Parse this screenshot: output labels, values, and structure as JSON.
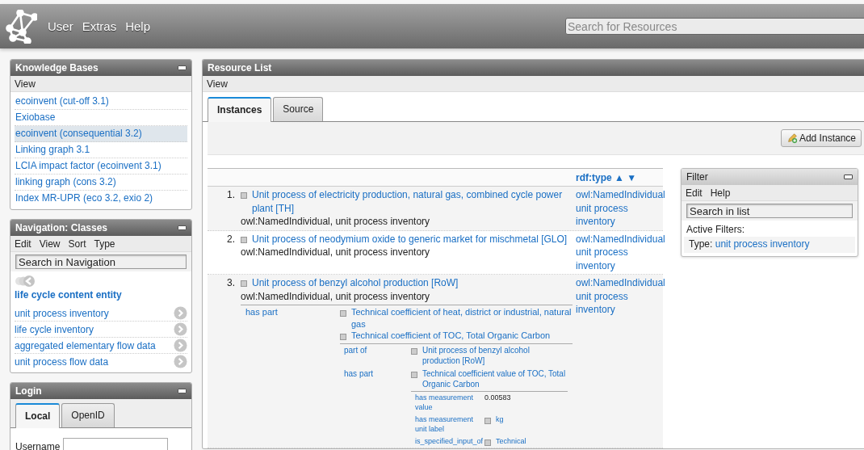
{
  "header": {
    "menu": [
      "User",
      "Extras",
      "Help"
    ],
    "search": {
      "placeholder": "Search for Resources"
    }
  },
  "knowledge_bases": {
    "title": "Knowledge Bases",
    "menu": [
      "View"
    ],
    "items": [
      {
        "label": "ecoinvent (cut-off 3.1)",
        "selected": false
      },
      {
        "label": "Exiobase",
        "selected": false
      },
      {
        "label": "ecoinvent (consequential 3.2)",
        "selected": true
      },
      {
        "label": "Linking graph 3.1",
        "selected": false
      },
      {
        "label": "LCIA impact factor (ecoinvent 3.1)",
        "selected": false
      },
      {
        "label": "linking graph (cons 3.2)",
        "selected": false
      },
      {
        "label": "Index MR-UPR (eco 3.2, exio 2)",
        "selected": false
      }
    ]
  },
  "navigation": {
    "title": "Navigation: Classes",
    "menu": [
      "Edit",
      "View",
      "Sort",
      "Type"
    ],
    "search": {
      "placeholder": "Search in Navigation"
    },
    "current": "life cycle content entity",
    "items": [
      "unit process inventory",
      "life cycle inventory",
      "aggregated elementary flow data",
      "unit process flow data"
    ]
  },
  "login": {
    "title": "Login",
    "tabs": [
      {
        "label": "Local",
        "selected": true
      },
      {
        "label": "OpenID",
        "selected": false
      }
    ],
    "username_label": "Username"
  },
  "resource_list": {
    "title": "Resource List",
    "menu": [
      "View"
    ],
    "tabs": [
      {
        "label": "Instances",
        "selected": true
      },
      {
        "label": "Source",
        "selected": false
      }
    ],
    "add_button": "Add Instance",
    "type_column": "rdf:type ▲ ▼",
    "rows": [
      {
        "number": "1.",
        "title": "Unit process of electricity production, natural gas, combined cycle power plant [TH]",
        "subtitle": "owl:NamedIndividual, unit process inventory",
        "types": [
          "owl:NamedIndividual",
          "unit process inventory"
        ]
      },
      {
        "number": "2.",
        "title": "Unit process of neodymium oxide to generic market for mischmetal [GLO]",
        "subtitle": "owl:NamedIndividual, unit process inventory",
        "types": [
          "owl:NamedIndividual",
          "unit process inventory"
        ]
      },
      {
        "number": "3.",
        "title": "Unit process of benzyl alcohol production [RoW]",
        "subtitle": "owl:NamedIndividual, unit process inventory",
        "types": [
          "owl:NamedIndividual",
          "unit process inventory"
        ],
        "properties": [
          {
            "name": "has part",
            "values": [
              {
                "title": "Technical coefficient of heat, district or industrial, natural gas"
              },
              {
                "title": "Technical coefficient of TOC, Total Organic Carbon",
                "properties": [
                  {
                    "name": "part of",
                    "values": [
                      {
                        "title": "Unit process of benzyl alcohol production [RoW]"
                      }
                    ]
                  },
                  {
                    "name": "has part",
                    "values": [
                      {
                        "title": "Technical coefficient value of TOC, Total Organic Carbon",
                        "properties": [
                          {
                            "name": "has measurement value",
                            "value": "0.00583"
                          },
                          {
                            "name": "has measurement unit label",
                            "values": [
                              {
                                "title": "kg"
                              }
                            ]
                          },
                          {
                            "name": "is_specified_input_of",
                            "values": [
                              {
                                "title": "Technical"
                              }
                            ]
                          }
                        ]
                      }
                    ]
                  }
                ]
              }
            ]
          }
        ]
      }
    ]
  },
  "filter": {
    "title": "Filter",
    "menu": [
      "Edit",
      "Help"
    ],
    "search": {
      "placeholder": "Search in list"
    },
    "active_label": "Active Filters:",
    "active": [
      {
        "key": "Type:",
        "value": "unit process inventory"
      }
    ]
  }
}
